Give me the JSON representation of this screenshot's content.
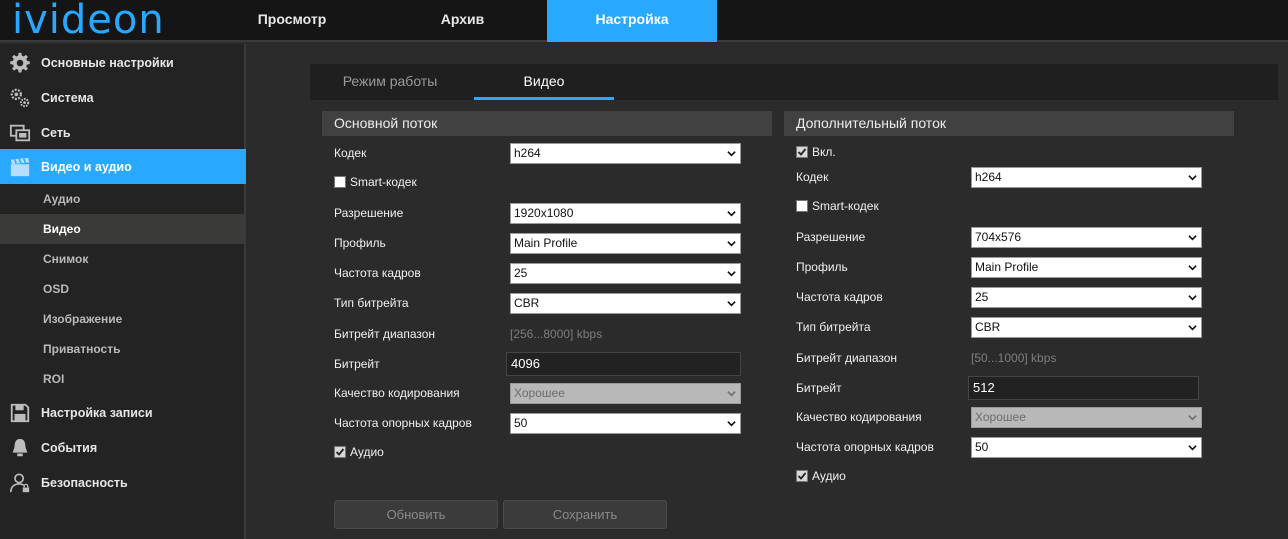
{
  "brand": {
    "logo_text": "ivideon",
    "accent": "#29a8ff"
  },
  "top_nav": {
    "tabs": [
      {
        "label": "Просмотр",
        "active": false
      },
      {
        "label": "Архив",
        "active": false
      },
      {
        "label": "Настройка",
        "active": true
      }
    ]
  },
  "sidebar": {
    "items": [
      {
        "label": "Основные настройки",
        "icon": "gear-icon"
      },
      {
        "label": "Система",
        "icon": "gears-icon"
      },
      {
        "label": "Сеть",
        "icon": "network-icon"
      },
      {
        "label": "Видео и аудио",
        "icon": "clapperboard-icon",
        "active": true
      },
      {
        "label": "Настройка записи",
        "icon": "floppy-icon"
      },
      {
        "label": "События",
        "icon": "bell-icon"
      },
      {
        "label": "Безопасность",
        "icon": "user-lock-icon"
      }
    ],
    "subitems": [
      {
        "label": "Аудио"
      },
      {
        "label": "Видео",
        "active": true
      },
      {
        "label": "Снимок"
      },
      {
        "label": "OSD"
      },
      {
        "label": "Изображение"
      },
      {
        "label": "Приватность"
      },
      {
        "label": "ROI"
      }
    ]
  },
  "subtabs": [
    {
      "label": "Режим работы",
      "active": false
    },
    {
      "label": "Видео",
      "active": true
    }
  ],
  "main_stream": {
    "title": "Основной поток",
    "codec_label": "Кодек",
    "codec_value": "h264",
    "smart_codec_label": "Smart-кодек",
    "smart_codec_checked": false,
    "resolution_label": "Разрешение",
    "resolution_value": "1920x1080",
    "profile_label": "Профиль",
    "profile_value": "Main Profile",
    "fps_label": "Частота кадров",
    "fps_value": "25",
    "bitrate_type_label": "Тип битрейта",
    "bitrate_type_value": "CBR",
    "bitrate_range_label": "Битрейт диапазон",
    "bitrate_range_value": "[256...8000] kbps",
    "bitrate_label": "Битрейт",
    "bitrate_value": "4096",
    "quality_label": "Качество кодирования",
    "quality_value": "Хорошее",
    "gop_label": "Частота опорных кадров",
    "gop_value": "50",
    "audio_label": "Аудио",
    "audio_checked": true
  },
  "sub_stream": {
    "title": "Дополнительный поток",
    "enabled_label": "Вкл.",
    "enabled_checked": true,
    "codec_label": "Кодек",
    "codec_value": "h264",
    "smart_codec_label": "Smart-кодек",
    "smart_codec_checked": false,
    "resolution_label": "Разрешение",
    "resolution_value": "704x576",
    "profile_label": "Профиль",
    "profile_value": "Main Profile",
    "fps_label": "Частота кадров",
    "fps_value": "25",
    "bitrate_type_label": "Тип битрейта",
    "bitrate_type_value": "CBR",
    "bitrate_range_label": "Битрейт диапазон",
    "bitrate_range_value": "[50...1000] kbps",
    "bitrate_label": "Битрейт",
    "bitrate_value": "512",
    "quality_label": "Качество кодирования",
    "quality_value": "Хорошее",
    "gop_label": "Частота опорных кадров",
    "gop_value": "50",
    "audio_label": "Аудио",
    "audio_checked": true
  },
  "buttons": {
    "refresh_label": "Обновить",
    "save_label": "Сохранить"
  }
}
